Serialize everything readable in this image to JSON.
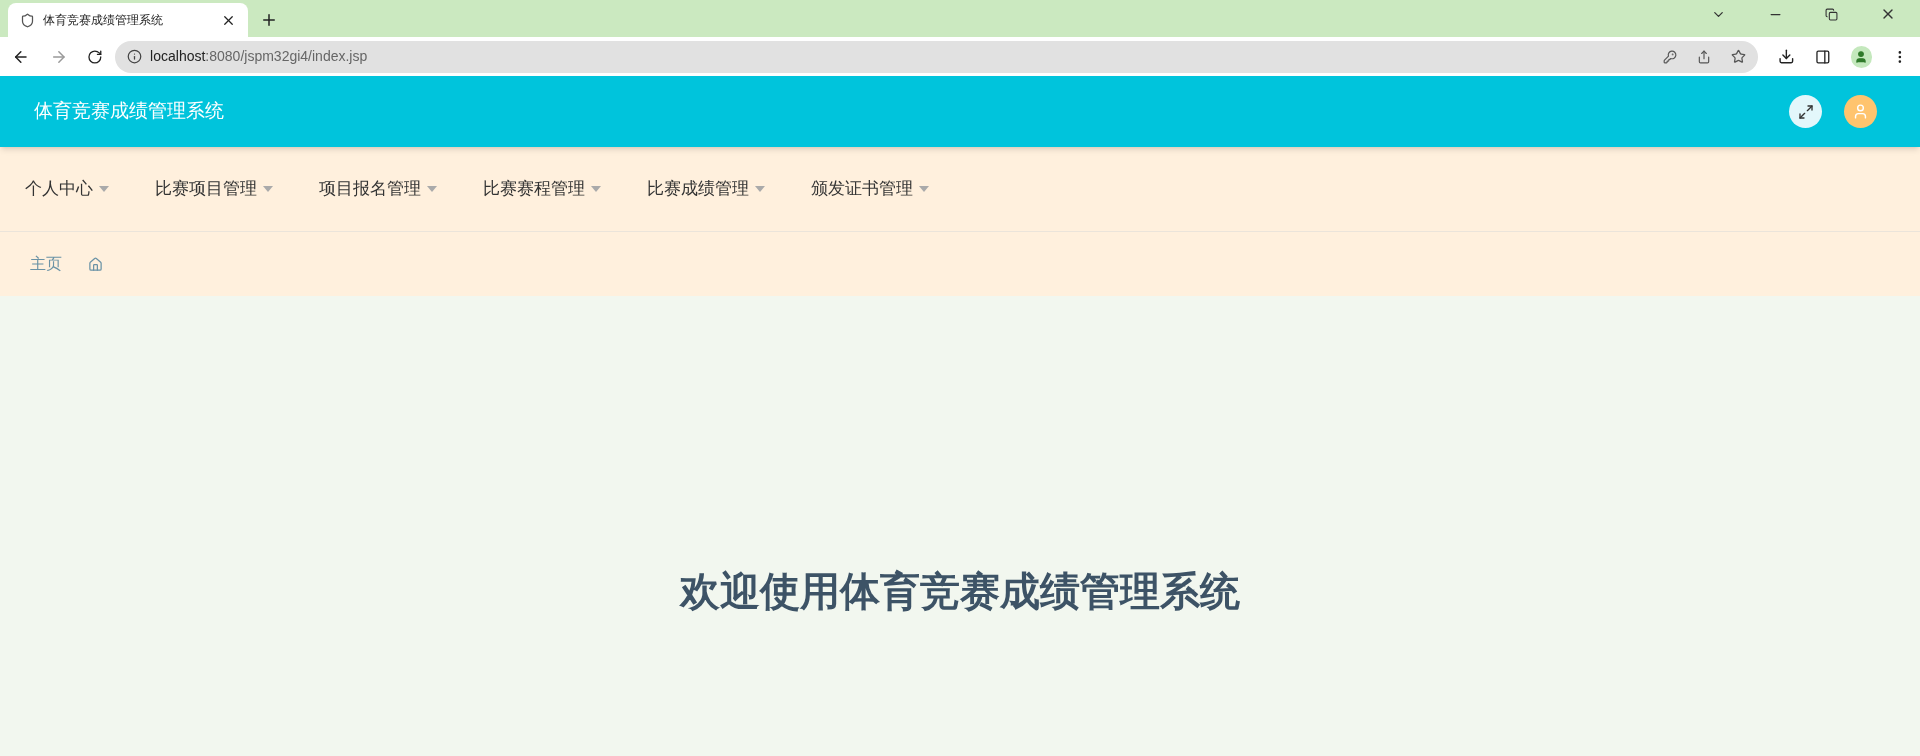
{
  "browser": {
    "tab_title": "体育竞赛成绩管理系统",
    "url_host": "localhost",
    "url_rest": ":8080/jspm32gi4/index.jsp"
  },
  "header": {
    "title": "体育竞赛成绩管理系统"
  },
  "nav": [
    {
      "label": "个人中心"
    },
    {
      "label": "比赛项目管理"
    },
    {
      "label": "项目报名管理"
    },
    {
      "label": "比赛赛程管理"
    },
    {
      "label": "比赛成绩管理"
    },
    {
      "label": "颁发证书管理"
    }
  ],
  "breadcrumb": {
    "label": "主页"
  },
  "welcome": "欢迎使用体育竞赛成绩管理系统"
}
